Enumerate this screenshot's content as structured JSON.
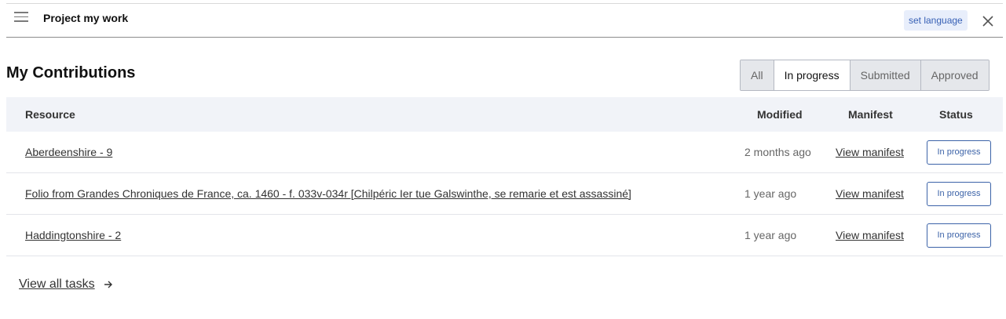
{
  "header": {
    "title": "Project my work",
    "language_button": "set language",
    "icons": [
      "menu-icon",
      "close-icon"
    ]
  },
  "section": {
    "title": "My Contributions"
  },
  "filters": [
    {
      "label": "All",
      "active": false
    },
    {
      "label": "In progress",
      "active": true
    },
    {
      "label": "Submitted",
      "active": false
    },
    {
      "label": "Approved",
      "active": false
    }
  ],
  "table": {
    "headers": {
      "resource": "Resource",
      "modified": "Modified",
      "manifest": "Manifest",
      "status": "Status"
    },
    "rows": [
      {
        "resource": "Aberdeenshire - 9",
        "modified": "2 months ago",
        "manifest": "View manifest",
        "status": "In progress"
      },
      {
        "resource": "Folio from Grandes Chroniques de France, ca. 1460 - f. 033v-034r [Chilpéric Ier tue Galswinthe, se remarie et est assassiné]",
        "modified": "1 year ago",
        "manifest": "View manifest",
        "status": "In progress"
      },
      {
        "resource": "Haddingtonshire - 2",
        "modified": "1 year ago",
        "manifest": "View manifest",
        "status": "In progress"
      }
    ]
  },
  "footer": {
    "view_all": "View all tasks",
    "icon": "arrow-right-icon"
  },
  "colors": {
    "accent": "#3c63a8",
    "header_bg": "#f1f3f8",
    "language_bg": "#e8eefb"
  }
}
